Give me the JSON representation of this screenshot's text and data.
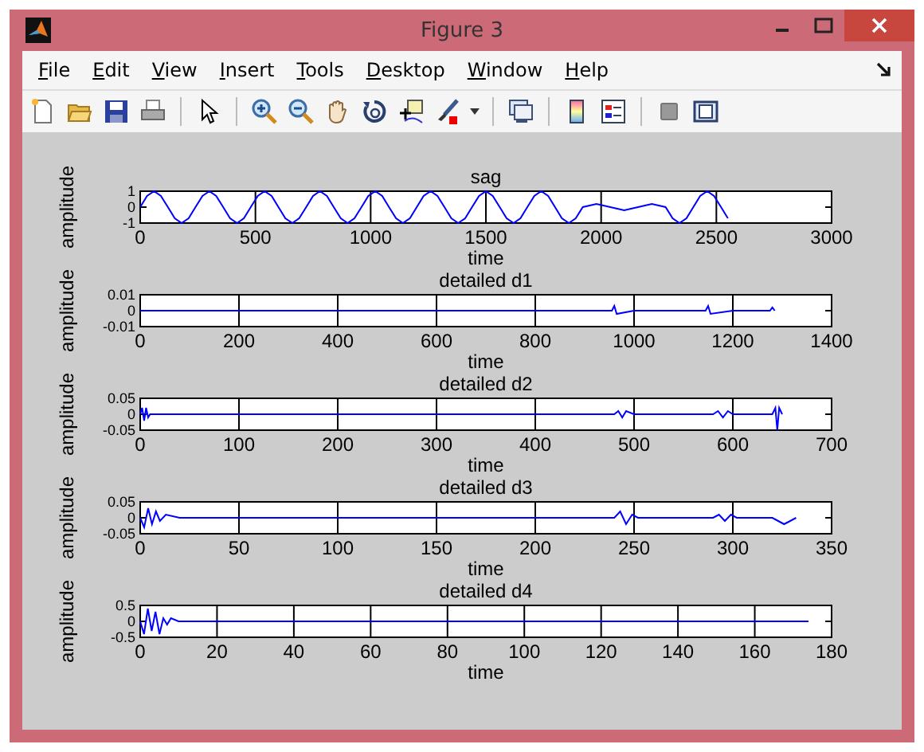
{
  "window": {
    "title": "Figure 3"
  },
  "menu": [
    "File",
    "Edit",
    "View",
    "Insert",
    "Tools",
    "Desktop",
    "Window",
    "Help"
  ],
  "plots": [
    {
      "chart_data": {
        "type": "line",
        "title": "sag",
        "xlabel": "time",
        "ylabel": "amplitude",
        "x": [
          0,
          30,
          60,
          90,
          120,
          150,
          180,
          210,
          240,
          270,
          300,
          330,
          360,
          390,
          420,
          450,
          480,
          510,
          540,
          570,
          600,
          630,
          660,
          690,
          720,
          750,
          780,
          810,
          840,
          870,
          900,
          930,
          960,
          990,
          1020,
          1050,
          1080,
          1110,
          1140,
          1170,
          1200,
          1230,
          1260,
          1290,
          1320,
          1350,
          1380,
          1410,
          1440,
          1470,
          1500,
          1530,
          1560,
          1590,
          1620,
          1650,
          1680,
          1710,
          1740,
          1770,
          1800,
          1830,
          1860,
          1890,
          1920,
          1950,
          1980,
          2010,
          2040,
          2070,
          2100,
          2130,
          2160,
          2190,
          2220,
          2250,
          2280,
          2310,
          2340,
          2370,
          2400,
          2430,
          2460,
          2490,
          2520,
          2550
        ],
        "series": [
          {
            "color": "#0000ff",
            "values": [
              0,
              0.7,
              1,
              0.7,
              0,
              -0.7,
              -1,
              -0.7,
              0,
              0.7,
              1,
              0.7,
              0,
              -0.7,
              -1,
              -0.7,
              0,
              0.7,
              1,
              0.7,
              0,
              -0.7,
              -1,
              -0.7,
              0,
              0.7,
              1,
              0.7,
              0,
              -0.7,
              -1,
              -0.7,
              0,
              0.7,
              1,
              0.7,
              0,
              -0.7,
              -1,
              -0.7,
              0,
              0.7,
              1,
              0.7,
              0,
              -0.7,
              -1,
              -0.7,
              0,
              0.7,
              1,
              0.7,
              0,
              -0.7,
              -1,
              -0.7,
              0,
              0.7,
              1,
              0.7,
              0,
              -0.7,
              -1,
              -0.7,
              0,
              0.1,
              0.2,
              0.1,
              0,
              -0.1,
              -0.2,
              -0.1,
              0,
              0.1,
              0.2,
              0.1,
              0,
              -0.7,
              -1,
              -0.7,
              0,
              0.7,
              1,
              0.7,
              0,
              -0.7
            ]
          }
        ],
        "xlim": [
          0,
          3000
        ],
        "ylim": [
          -1,
          1
        ],
        "xticks": [
          0,
          500,
          1000,
          1500,
          2000,
          2500,
          3000
        ],
        "yticks": [
          -1,
          0,
          1
        ],
        "grid": true
      }
    },
    {
      "chart_data": {
        "type": "line",
        "title": "detailed d1",
        "xlabel": "time",
        "ylabel": "amplitude",
        "x": [
          0,
          100,
          200,
          300,
          400,
          500,
          600,
          700,
          800,
          900,
          955,
          960,
          965,
          1000,
          1100,
          1145,
          1150,
          1155,
          1200,
          1275,
          1280,
          1285
        ],
        "series": [
          {
            "color": "#0000ff",
            "values": [
              0,
              0,
              0,
              0,
              0,
              0,
              0,
              0,
              0,
              0,
              0,
              0.003,
              -0.002,
              0,
              0,
              0,
              0.003,
              -0.002,
              0,
              0,
              0.002,
              0
            ]
          }
        ],
        "xlim": [
          0,
          1400
        ],
        "ylim": [
          -0.01,
          0.01
        ],
        "xticks": [
          0,
          200,
          400,
          600,
          800,
          1000,
          1200,
          1400
        ],
        "yticks": [
          -0.01,
          0,
          0.01
        ],
        "grid": true
      }
    },
    {
      "chart_data": {
        "type": "line",
        "title": "detailed d2",
        "xlabel": "time",
        "ylabel": "amplitude",
        "x": [
          0,
          2,
          4,
          6,
          8,
          10,
          50,
          100,
          150,
          200,
          250,
          300,
          350,
          400,
          450,
          480,
          484,
          488,
          492,
          500,
          550,
          580,
          585,
          590,
          595,
          600,
          640,
          643,
          645,
          647,
          650
        ],
        "series": [
          {
            "color": "#0000ff",
            "values": [
              0,
              0.02,
              -0.02,
              0.02,
              -0.01,
              0,
              0,
              0,
              0,
              0,
              0,
              0,
              0,
              0,
              0,
              0,
              0.01,
              -0.01,
              0.01,
              0,
              0,
              0,
              0.01,
              -0.01,
              0.01,
              0,
              0,
              0.02,
              -0.05,
              0.02,
              0
            ]
          }
        ],
        "xlim": [
          0,
          700
        ],
        "ylim": [
          -0.05,
          0.05
        ],
        "xticks": [
          0,
          100,
          200,
          300,
          400,
          500,
          600,
          700
        ],
        "yticks": [
          -0.05,
          0,
          0.05
        ],
        "grid": true
      }
    },
    {
      "chart_data": {
        "type": "line",
        "title": "detailed d3",
        "xlabel": "time",
        "ylabel": "amplitude",
        "x": [
          0,
          2,
          4,
          6,
          8,
          10,
          13,
          20,
          50,
          100,
          150,
          200,
          240,
          243,
          246,
          249,
          252,
          290,
          293,
          296,
          299,
          302,
          320,
          323,
          326,
          329,
          332
        ],
        "series": [
          {
            "color": "#0000ff",
            "values": [
              0,
              -0.03,
              0.03,
              -0.02,
              0.02,
              -0.01,
              0.01,
              0,
              0,
              0,
              0,
              0,
              0,
              0.02,
              -0.02,
              0.01,
              0,
              0,
              0.01,
              -0.01,
              0.01,
              0,
              0,
              -0.01,
              -0.02,
              -0.01,
              0
            ]
          }
        ],
        "xlim": [
          0,
          350
        ],
        "ylim": [
          -0.05,
          0.05
        ],
        "xticks": [
          0,
          50,
          100,
          150,
          200,
          250,
          300,
          350
        ],
        "yticks": [
          -0.05,
          0,
          0.05
        ],
        "grid": true
      }
    },
    {
      "chart_data": {
        "type": "line",
        "title": "detailed d4",
        "xlabel": "time",
        "ylabel": "amplitude",
        "x": [
          0,
          1,
          2,
          3,
          4,
          5,
          6,
          7,
          8,
          10,
          20,
          30,
          40,
          50,
          60,
          70,
          80,
          90,
          100,
          110,
          120,
          130,
          140,
          150,
          160,
          170,
          174
        ],
        "series": [
          {
            "color": "#0000ff",
            "values": [
              0,
              -0.4,
              0.4,
              -0.3,
              0.3,
              -0.4,
              0.1,
              -0.1,
              0.1,
              0,
              0,
              0,
              0,
              0,
              0,
              0,
              0,
              0,
              0,
              0,
              0,
              0,
              0,
              0,
              0,
              0,
              0
            ]
          }
        ],
        "xlim": [
          0,
          180
        ],
        "ylim": [
          -0.5,
          0.5
        ],
        "xticks": [
          0,
          20,
          40,
          60,
          80,
          100,
          120,
          140,
          160,
          180
        ],
        "yticks": [
          -0.5,
          0,
          0.5
        ],
        "grid": true
      }
    }
  ]
}
